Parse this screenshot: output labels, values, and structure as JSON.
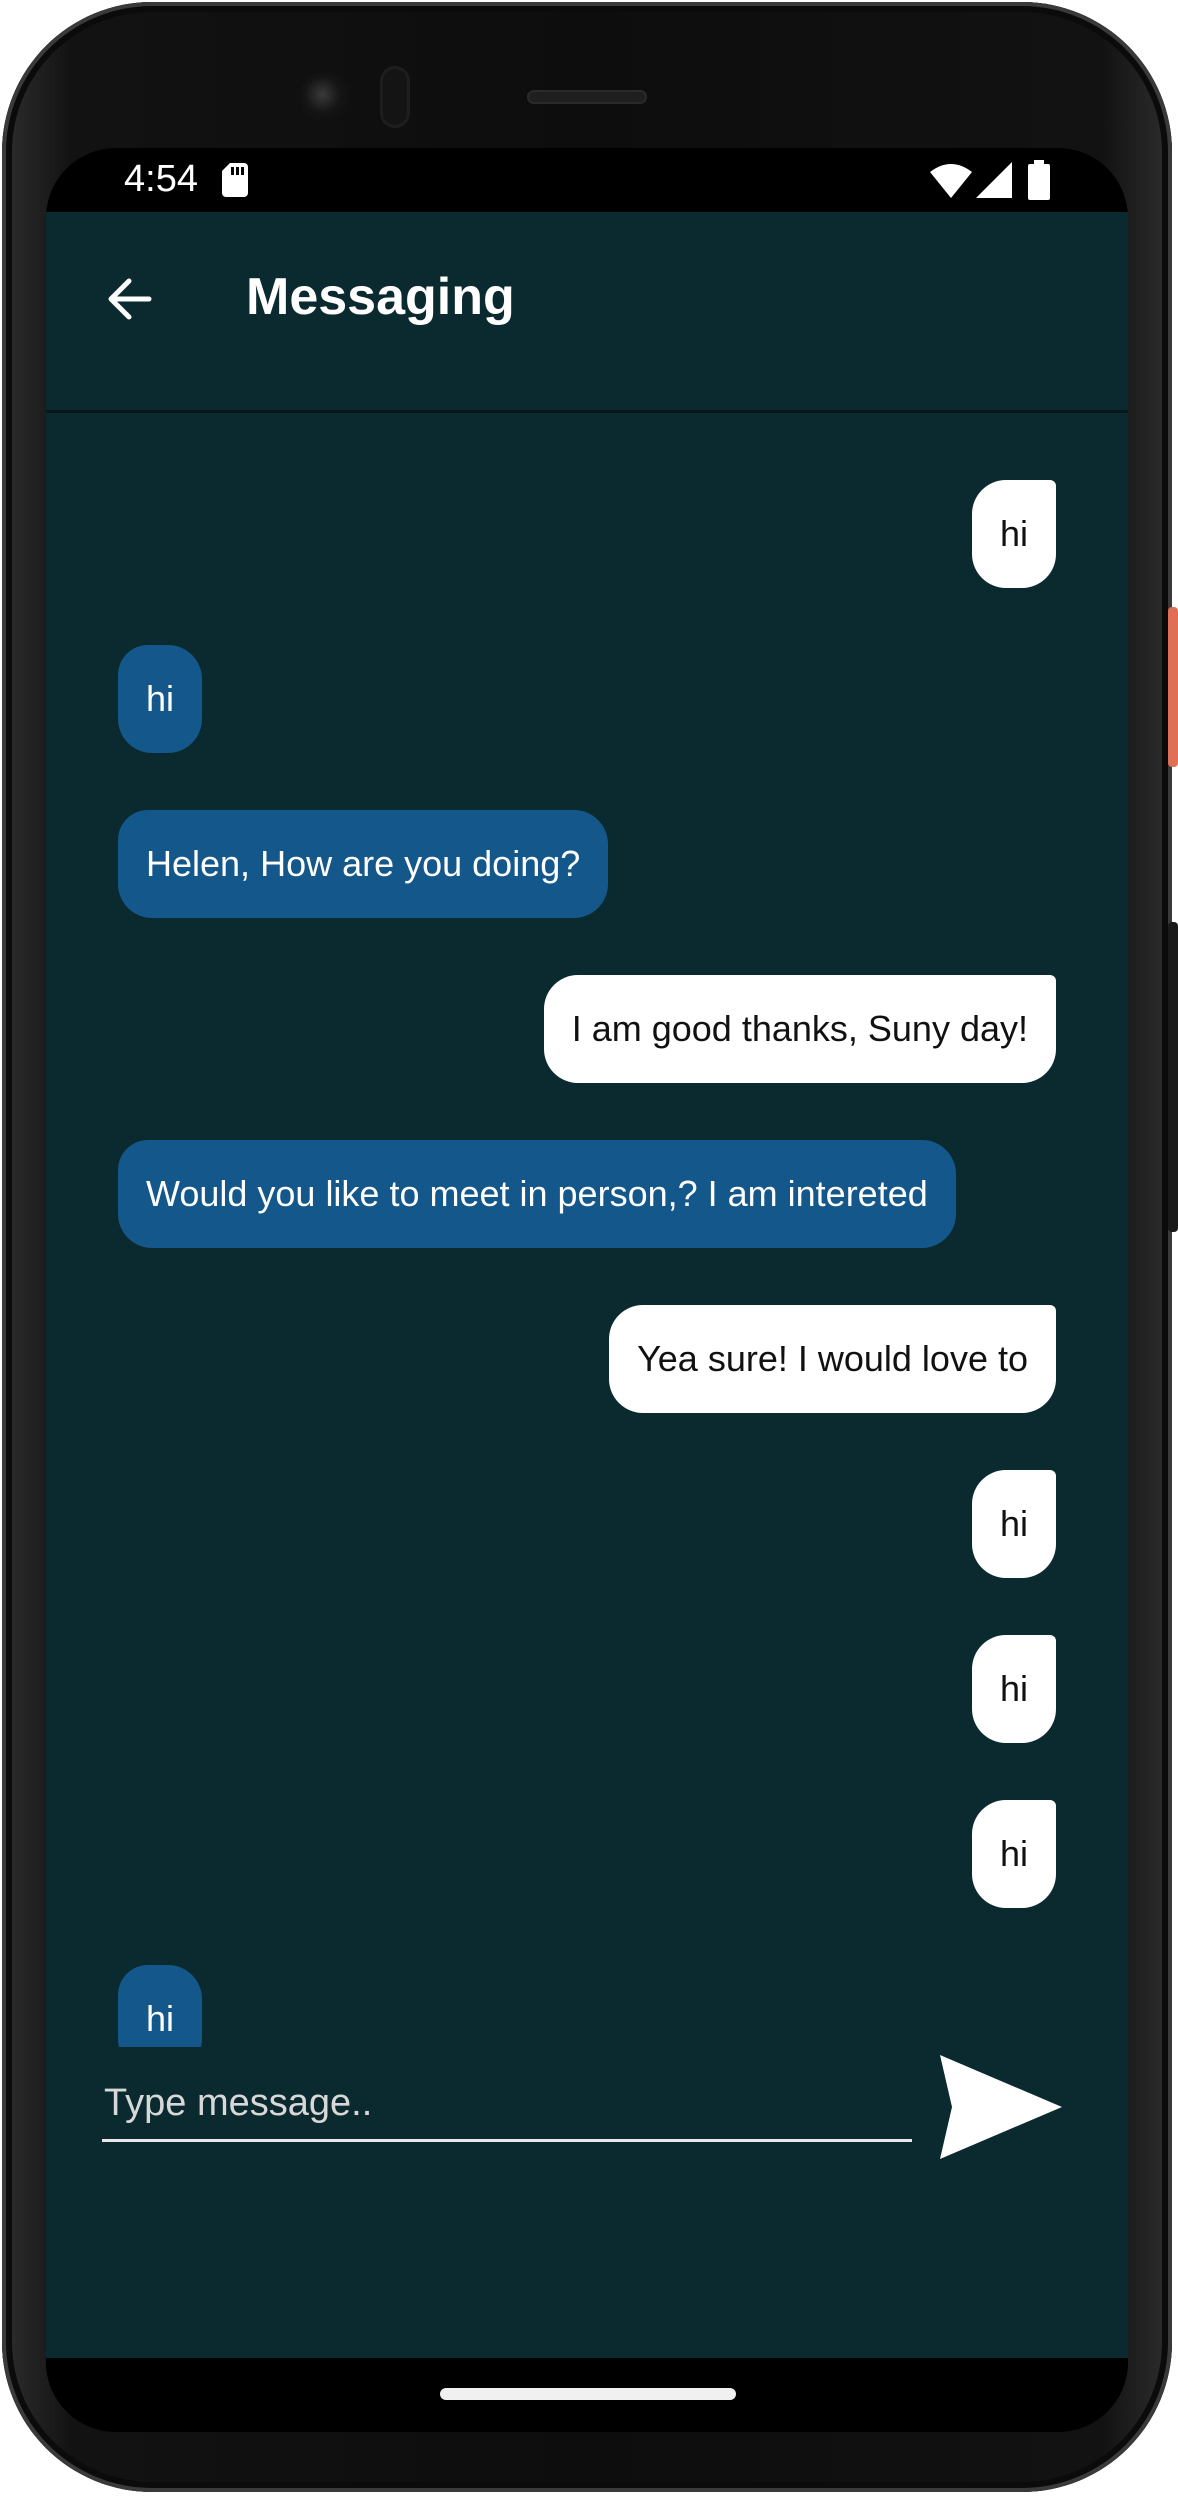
{
  "status_bar": {
    "time": "4:54",
    "icons": [
      "sd-card-icon",
      "wifi-icon",
      "signal-icon",
      "battery-icon"
    ]
  },
  "app_bar": {
    "title": "Messaging",
    "back_icon": "arrow-left-icon"
  },
  "messages": [
    {
      "text": "hi",
      "direction": "sent"
    },
    {
      "text": "hi",
      "direction": "received"
    },
    {
      "text": "Helen, How are you doing?",
      "direction": "received"
    },
    {
      "text": "I am good thanks, Suny day!",
      "direction": "sent"
    },
    {
      "text": "Would you like to meet in person,? I am intereted",
      "direction": "received"
    },
    {
      "text": "Yea sure! I would love to",
      "direction": "sent"
    },
    {
      "text": "hi",
      "direction": "sent"
    },
    {
      "text": "hi",
      "direction": "sent"
    },
    {
      "text": "hi",
      "direction": "sent"
    },
    {
      "text": "hi",
      "direction": "received"
    }
  ],
  "composer": {
    "placeholder": "Type message..",
    "value": "",
    "send_icon": "send-icon"
  },
  "colors": {
    "background": "#0a2a2f",
    "app_bar": "#0b2a2f",
    "sent_bubble": "#ffffff",
    "received_bubble": "#14578a"
  }
}
